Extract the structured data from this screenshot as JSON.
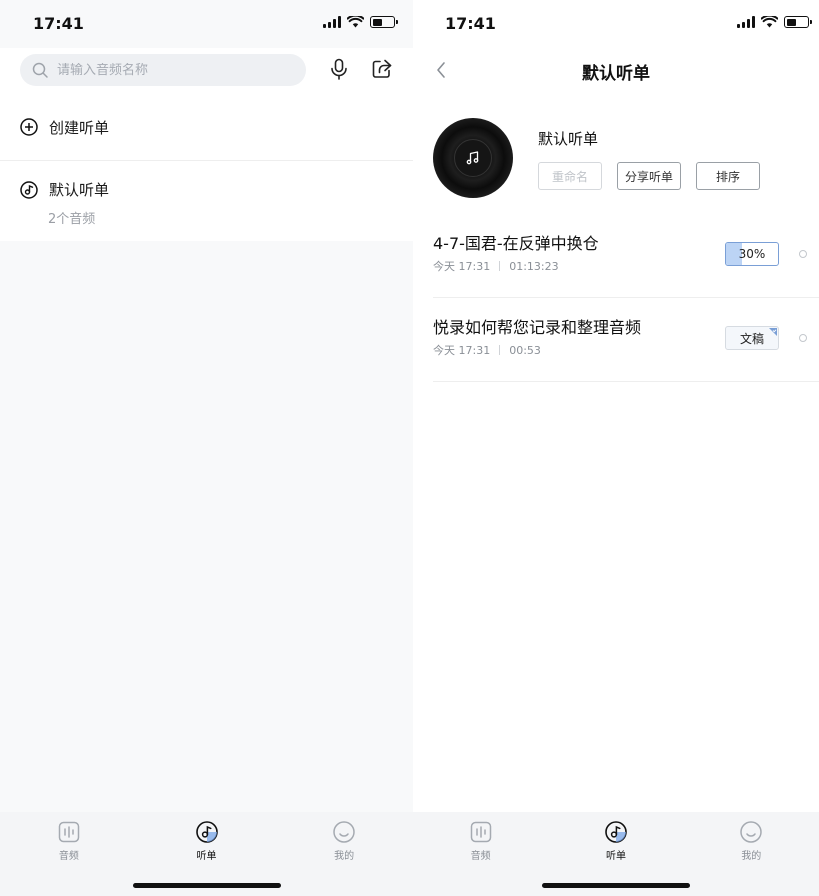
{
  "left": {
    "status_time": "17:41",
    "search": {
      "placeholder": "请输入音频名称"
    },
    "create_label": "创建听单",
    "playlist": {
      "name": "默认听单",
      "count": "2个音频"
    }
  },
  "right": {
    "status_time": "17:41",
    "nav_title": "默认听单",
    "playlist_title": "默认听单",
    "buttons": {
      "rename": "重命名",
      "share": "分享听单",
      "sort": "排序"
    },
    "items": [
      {
        "title": "4-7-国君-在反弹中换仓",
        "date": "今天 17:31",
        "duration": "01:13:23",
        "progress_label": "30%",
        "progress": 0.3
      },
      {
        "title": "悦录如何帮您记录和整理音频",
        "date": "今天 17:31",
        "duration": "00:53",
        "badge": "文稿"
      }
    ]
  },
  "tabs": [
    {
      "label": "音频",
      "icon": "audio-icon"
    },
    {
      "label": "听单",
      "icon": "playlist-disc-icon",
      "active": true
    },
    {
      "label": "我的",
      "icon": "smiley-icon"
    }
  ],
  "colors": {
    "accent": "#7a9fd6",
    "progress_fill": "#bcd4f5",
    "text": "#111111",
    "muted": "#8a8f96"
  }
}
